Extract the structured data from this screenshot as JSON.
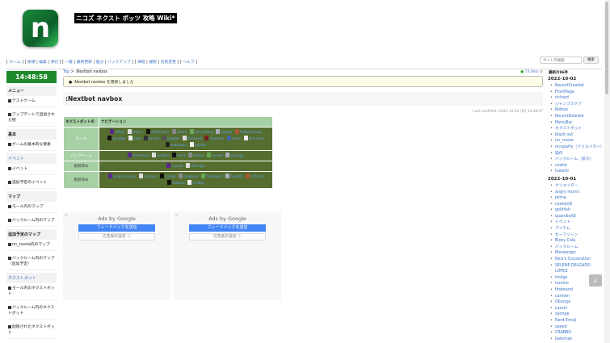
{
  "site": {
    "title": "ニコズ ネクスト ボッツ 攻略 Wiki*",
    "logo_letter": "n"
  },
  "topnav": [
    [
      "ホーム"
    ],
    [
      "新規",
      "編集",
      "添付"
    ],
    [
      "一覧",
      "最終更新",
      "差分",
      "バックアップ"
    ],
    [
      "凍結",
      "複製",
      "名前変更"
    ],
    [
      "ヘルプ"
    ]
  ],
  "search": {
    "placeholder": "サイト内検索",
    "button": "検索"
  },
  "clock": "14:48:58",
  "left_menu": [
    {
      "type": "h",
      "label": "メニュー"
    },
    {
      "type": "i",
      "label": "テストゲーム"
    },
    {
      "type": "i",
      "label": "アップデートで追加された物"
    },
    {
      "type": "h",
      "label": "基本"
    },
    {
      "type": "i",
      "label": "ゲームの基本的な要素"
    },
    {
      "type": "ev",
      "label": "イベント"
    },
    {
      "type": "i",
      "label": "イベント"
    },
    {
      "type": "i",
      "label": "追加予定のイベント"
    },
    {
      "type": "h",
      "label": "マップ"
    },
    {
      "type": "i",
      "label": "モール内のマップ"
    },
    {
      "type": "i",
      "label": "バックルーム内のマップ"
    },
    {
      "type": "h",
      "label": "追加予定のマップ"
    },
    {
      "type": "i",
      "label": "nn_russia内のマップ"
    },
    {
      "type": "i",
      "label": "バックルーム内のマップ（追加予定）"
    },
    {
      "type": "ev",
      "label": "ネクストボット"
    },
    {
      "type": "i",
      "label": "モール内のネクストボット"
    },
    {
      "type": "i",
      "label": "バックルーム内のネクストボット"
    },
    {
      "type": "i",
      "label": "削除されたネクストボット"
    }
  ],
  "breadcrumb": {
    "top": "Top",
    "sep": " > ",
    "current": ":Nextbot navbox"
  },
  "perf": "73.9ms",
  "notice": ":Nextbot navbox を更新しました",
  "page_title": ":Nextbot navbox",
  "last_modified": "Last-modified: 2022-10-02 (日) 14:48:47",
  "navbox": {
    "header": [
      "ネクストボットの",
      "ナビゲーション"
    ],
    "rows": [
      {
        "label": "モール",
        "link": true,
        "bots": [
          "afton",
          "shano",
          "aftermans",
          "aooni",
          "armstrong",
          "cootie",
          "fazbearmug",
          "grudge",
          "idiot",
          "jerma",
          "jungler",
          "Pinhead",
          "quandie",
          "sanic",
          "thinman",
          "unknown",
          "yoshie"
        ]
      },
      {
        "label": "バックルーム",
        "link": true,
        "bots": [
          "bateman",
          "crabbo",
          "nerd",
          "roblox",
          "speed",
          "sponge"
        ]
      },
      {
        "label": "削除済み",
        "link": false,
        "bots": [
          "Laurel",
          "Obunga"
        ]
      },
      {
        "label": "削除済み",
        "link": false,
        "bots": [
          "angry munci",
          "carmen",
          "carter",
          "delgado",
          "firebrand",
          "fuwatti",
          "richard",
          "tomino",
          "trollge"
        ]
      }
    ]
  },
  "ads": {
    "by": "Ads by Google",
    "feedback": "フィードバックを送信",
    "settings": "広告表示設定 ⓘ"
  },
  "recent": {
    "title": "最新の96件",
    "groups": [
      {
        "date": "2022-10-02",
        "items": [
          "RecentCreated",
          "FrontPage",
          "richard",
          "ジャンプスケア",
          "Roblox",
          "RecentDeleted",
          "MenuBar",
          "ネクストボット",
          "black out",
          "nn_russia",
          "nicopatty（クリエイター）",
          "操作",
          "バックルーム（拡大）",
          "cootie",
          "fuwatti"
        ]
      },
      {
        "date": "2022-10-01",
        "items": [
          "クリエイター",
          "angry munci",
          "jerma",
          "cootie/旧",
          "goldfish",
          "quandie/旧",
          "イベント",
          "アイテム",
          "セーフゾーン",
          "Bloxy Cola",
          "バックルーム",
          "Messenger",
          "Nico's Corporation",
          "SELENE DELGADO LOPEZ",
          "trollge",
          "tomino",
          "firebrand",
          "carmen",
          "Obunga",
          "Laurel",
          "sponge",
          "Nerd Emoji",
          "speed",
          "CRABBO",
          "bateman"
        ]
      }
    ]
  },
  "colors": {
    "clock": "#1f8a2a",
    "navbox_header": "#a7d0a4",
    "navbox_cell": "#556d2e",
    "link": "#3b73c7"
  }
}
